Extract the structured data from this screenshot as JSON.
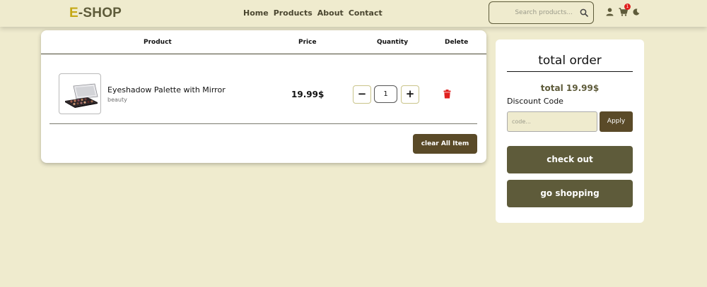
{
  "navbar": {
    "logo_first": "E",
    "logo_rest": "-SHOP",
    "links": [
      "Home",
      "Products",
      "About",
      "Contact"
    ],
    "search_placeholder": "Search products...",
    "cart_count": "1"
  },
  "cart": {
    "headers": {
      "product": "Product",
      "price": "Price",
      "quantity": "Quantity",
      "delete": "Delete"
    },
    "items": [
      {
        "name": "Eyeshadow Palette with Mirror",
        "category": "beauty",
        "price": "19.99$",
        "quantity": "1"
      }
    ],
    "decrement": "−",
    "increment": "+",
    "clear_label": "clear All Item"
  },
  "summary": {
    "title": "total order",
    "total": "total 19.99$",
    "discount_label": "Discount Code",
    "code_placeholder": "code...",
    "apply_label": "Apply",
    "checkout_label": "check out",
    "shopping_label": "go shopping"
  },
  "colors": {
    "background": "#efebce",
    "primary": "#5e5b3a",
    "dark_button": "#5a4a28",
    "logo_accent": "#c5a816",
    "delete_icon": "#e0211f"
  }
}
